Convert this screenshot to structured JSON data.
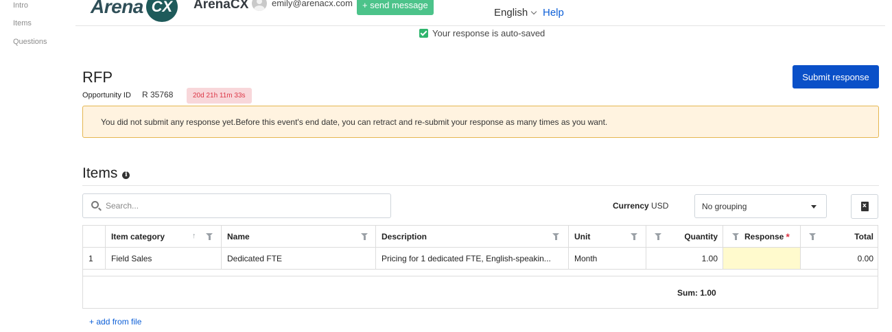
{
  "leftnav": {
    "items": [
      "Intro",
      "Items",
      "Questions"
    ]
  },
  "header": {
    "logo_text": "Arena",
    "logo_badge": "CX",
    "org_name": "ArenaCX",
    "user_email": "emily@arenacx.com",
    "send_message": "+ send message",
    "language": "English",
    "help": "Help"
  },
  "autosave": "Your response is auto-saved",
  "event": {
    "title": "RFP",
    "opportunity_label": "Opportunity ID",
    "opportunity_id": "R 35768",
    "timer": "20d 21h 11m 33s",
    "submit_label": "Submit response",
    "warning": "You did not submit any response yet.Before this event's end date, you can retract and re-submit your response as many times as you want."
  },
  "items": {
    "title": "Items",
    "info_icon_glyph": "i",
    "search_placeholder": "Search...",
    "currency_label": "Currency",
    "currency_value": "USD",
    "grouping": "No grouping",
    "columns": [
      "Item category",
      "Name",
      "Description",
      "Unit",
      "Quantity",
      "Response",
      "Total"
    ],
    "sort_glyph": "↑",
    "required_glyph": "*",
    "rows": [
      {
        "index": "1",
        "category": "Field Sales",
        "name": "Dedicated FTE",
        "description": "Pricing for 1 dedicated FTE, English-speakin...",
        "unit": "Month",
        "quantity": "1.00",
        "response": "",
        "total": "0.00"
      }
    ],
    "sum": "Sum: 1.00",
    "add_from_file": "+ add from file"
  }
}
